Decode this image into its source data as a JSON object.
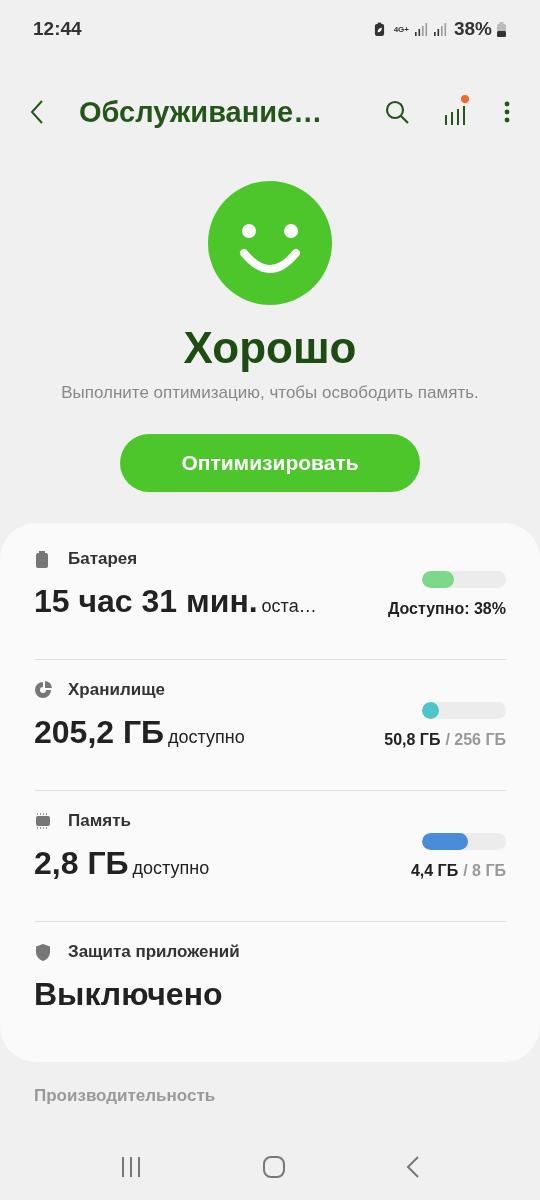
{
  "status_bar": {
    "time": "12:44",
    "network": "4G+",
    "battery": "38%"
  },
  "toolbar": {
    "title": "Обслуживание…",
    "stats_badge": true
  },
  "status": {
    "title": "Хорошо",
    "message": "Выполните оптимизацию, чтобы освободить память.",
    "button": "Оптимизировать"
  },
  "items": [
    {
      "kind": "battery",
      "label": "Батарея",
      "value": "15 час 31 мин.",
      "unit": "оста…",
      "level": 0.38,
      "color": "#7dd98a",
      "reading": "Доступно: 38%"
    },
    {
      "kind": "storage",
      "label": "Хранилище",
      "value": "205,2 ГБ",
      "unit": "доступно",
      "level": 0.2,
      "color": "#4ec5c8",
      "used": "50,8 ГБ",
      "total": "/ 256 ГБ"
    },
    {
      "kind": "memory",
      "label": "Память",
      "value": "2,8 ГБ",
      "unit": "доступно",
      "level": 0.55,
      "color": "#4a8cd8",
      "used": "4,4 ГБ",
      "total": "/ 8 ГБ"
    },
    {
      "kind": "protection",
      "label": "Защита приложений",
      "value": "Выключено"
    }
  ],
  "next_section": "Производительность"
}
